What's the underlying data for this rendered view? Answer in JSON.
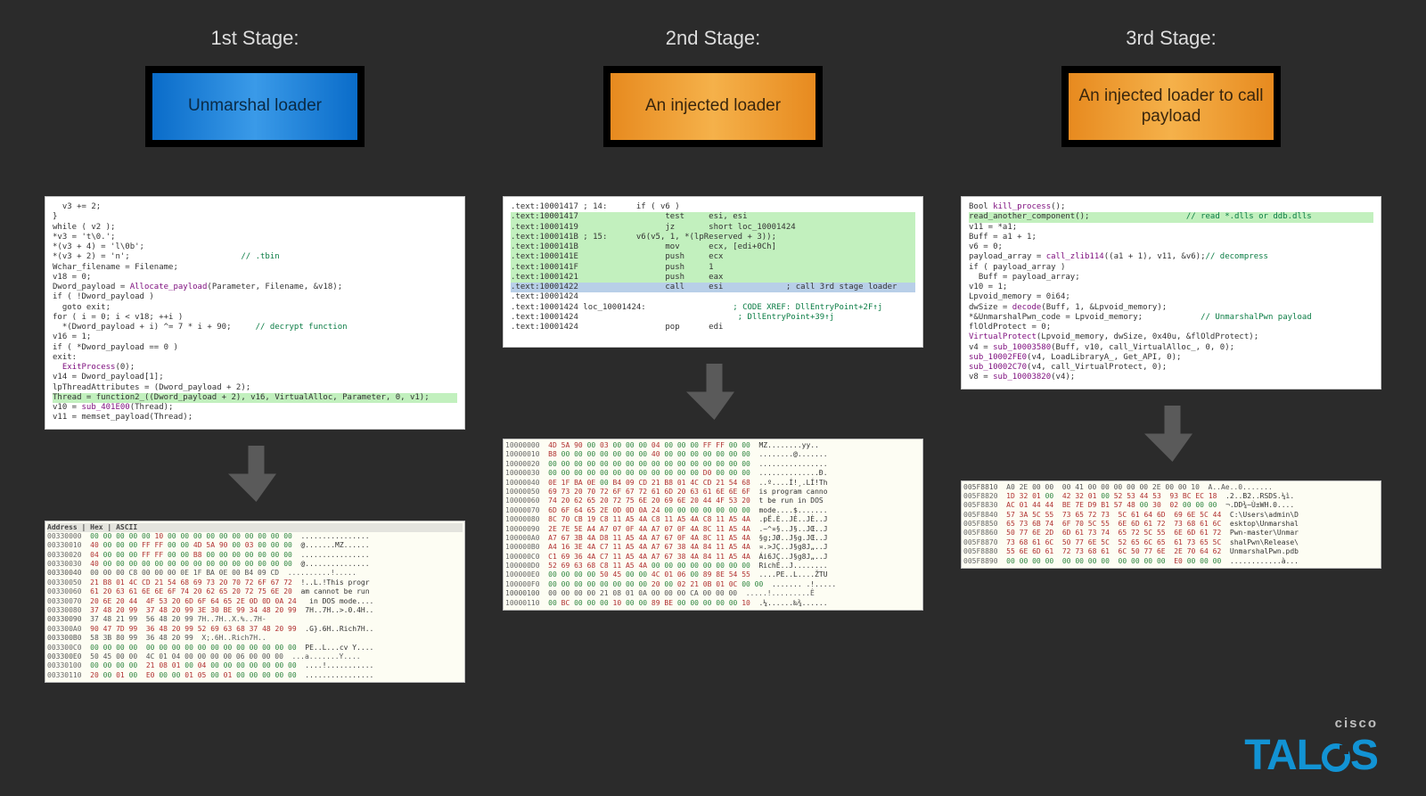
{
  "stages": [
    {
      "title": "1st Stage:",
      "badge": "Unmarshal loader",
      "badge_color": "blue"
    },
    {
      "title": "2nd Stage:",
      "badge": "An injected loader",
      "badge_color": "orange"
    },
    {
      "title": "3rd Stage:",
      "badge": "An injected loader to call payload",
      "badge_color": "orange"
    }
  ],
  "code": {
    "s1": [
      {
        "t": "  v3 += 2;"
      },
      {
        "t": "}"
      },
      {
        "t": "while ( v2 );"
      },
      {
        "t": "*v3 = 't\\0.';"
      },
      {
        "t": "*(v3 + 4) = 'l\\0b';"
      },
      {
        "t": "*(v3 + 2) = 'n';                       ",
        "cm": "// .tbin"
      },
      {
        "t": "Wchar_filename = Filename;"
      },
      {
        "t": "v18 = 0;"
      },
      {
        "t": "Dword_payload = ",
        "fn": "Allocate_payload",
        "t2": "(Parameter, Filename, &v18);"
      },
      {
        "t": "if ( !Dword_payload )"
      },
      {
        "t": "  goto exit;"
      },
      {
        "t": "for ( i = 0; i < v18; ++i )"
      },
      {
        "t": "  *(Dword_payload + i) ^= 7 * i + 90;     ",
        "cm": "// decrypt function"
      },
      {
        "t": "v16 = 1;"
      },
      {
        "t": "if ( *Dword_payload == 0 )"
      },
      {
        "t": "exit:"
      },
      {
        "t": "  ",
        "fn": "ExitProcess",
        "t2": "(0);"
      },
      {
        "t": "v14 = Dword_payload[1];"
      },
      {
        "t": "lpThreadAttributes = (Dword_payload + 2);"
      },
      {
        "hl": true,
        "t": "Thread = function2_((Dword_payload + 2), v16, VirtualAlloc, Parameter, 0, v1);"
      },
      {
        "t": "v10 = ",
        "fn": "sub_401E00",
        "t2": "(Thread);"
      },
      {
        "t": "v11 = memset_payload(Thread);"
      }
    ],
    "s2": [
      {
        "t": ".text:10001417 ; 14:      if ( v6 )"
      },
      {
        "hl": true,
        "t": ".text:10001417                  test     esi, esi"
      },
      {
        "hl": true,
        "t": ".text:10001419                  jz       short loc_10001424"
      },
      {
        "hl": true,
        "t": ".text:1000141B ; 15:      v6(v5, 1, *(lpReserved + 3));"
      },
      {
        "hl": true,
        "t": ".text:1000141B                  mov      ecx, [edi+0Ch]"
      },
      {
        "hl": true,
        "t": ".text:1000141E                  push     ecx"
      },
      {
        "hl": true,
        "t": ".text:1000141F                  push     1"
      },
      {
        "hl": true,
        "t": ".text:10001421                  push     eax"
      },
      {
        "bl": true,
        "t": ".text:10001422                  call     esi             ; call 3rd stage loader"
      },
      {
        "t": ".text:10001424"
      },
      {
        "t": ".text:10001424 loc_10001424:                  ",
        "cm": "; CODE XREF: DllEntryPoint+2F↑j"
      },
      {
        "t": ".text:10001424                                 ",
        "cm": "; DllEntryPoint+39↑j"
      },
      {
        "t": ".text:10001424                  pop      edi"
      }
    ],
    "s3": [
      {
        "t": "Bool ",
        "fn": "kill_process",
        "t2": "();"
      },
      {
        "hl": true,
        "t": "read_another_component();                    ",
        "cm": "// read *.dlls or ddb.dlls"
      },
      {
        "t": "v11 = *a1;"
      },
      {
        "t": "Buff = a1 + 1;"
      },
      {
        "t": "v6 = 0;"
      },
      {
        "t": "payload_array = ",
        "fn": "call_zlib114",
        "t2": "((a1 + 1), v11, &v6);",
        "cm": "// decompress"
      },
      {
        "t": "if ( payload_array )"
      },
      {
        "t": "  Buff = payload_array;"
      },
      {
        "t": "v10 = 1;"
      },
      {
        "t": "Lpvoid_memory = 0i64;"
      },
      {
        "t": "dwSize = ",
        "fn": "decode",
        "t2": "(Buff, 1, &Lpvoid_memory);"
      },
      {
        "t": "*&UnmarshalPwn_code = Lpvoid_memory;            ",
        "cm": "// UnmarshalPwn payload"
      },
      {
        "t": "flOldProtect = 0;"
      },
      {
        "fn": "VirtualProtect",
        "t2": "(Lpvoid_memory, dwSize, 0x40u, &flOldProtect);"
      },
      {
        "t": "v4 = ",
        "fn": "sub_10003580",
        "t2": "(Buff, v10, call_VirtualAlloc_, 0, 0);"
      },
      {
        "fn": "sub_10002FE0",
        "t2": "(v4, LoadLibraryA_, Get_API, 0);"
      },
      {
        "fn": "sub_10002C70",
        "t2": "(v4, call_VirtualProtect, 0);"
      },
      {
        "t": "v8 = ",
        "fn": "sub_10003820",
        "t2": "(v4);"
      }
    ]
  },
  "hex": {
    "s1_header": "Address  | Hex                                                 | ASCII",
    "s1_rows": [
      "00330000  00 00 00 00 00 10 00 00 00 00 00 00 00 00 00 00  ................",
      "00330010  40 00 00 00 FF FF 00 00 4D 5A 90 00 03 00 00 00  @.......MZ......",
      "00330020  04 00 00 00 FF FF 00 00 B8 00 00 00 00 00 00 00  ................",
      "00330030  40 00 00 00 00 00 00 00 00 00 00 00 00 00 00 00  @...............",
      "00330040  00 00 00 C8 00 00 00 0E 1F BA 0E 00 B4 09 CD  ..........!.....",
      "00330050  21 B8 01 4C CD 21 54 68 69 73 20 70 72 6F 67 72  !..L.!This progr",
      "00330060  61 20 63 61 6E 6E 6F 74 20 62 65 20 72 75 6E 20  am cannot be run",
      "00330070  20 6E 20 44  4F 53 20 6D 6F 64 65 2E 0D 0D 0A 24   in DOS mode....",
      "00330080  37 48 20 99  37 48 20 99 3E 30 BE 99 34 48 20 99  7H..7H..>.0.4H..",
      "00330090  37 48 21 99  56 48 20 99 7H..7H..X.%..7H-",
      "003300A0  90 47 7D 99  36 48 20 99 52 69 63 68 37 48 20 99  .G}.6H..Rich7H..",
      "003300B0  58 3B 80 99  36 48 20 99  X;.6H..Rich7H..",
      "003300C0  00 00 00 00  00 00 00 00 00 00 00 00 00 00 00 00  PE..L...cv Y....",
      "003300E0  50 45 00 00  4C 01 04 00 00 00 00 06 00 00 00  ...a.......Y....",
      "00330100  00 00 00 00  21 08 01 00 04 00 00 00 00 00 00 00  ....!...........",
      "00330110  20 00 01 00  E0 00 00 01 05 00 01 00 00 00 00 00  ................"
    ],
    "s2_rows": [
      "10000000  4D 5A 90 00 03 00 00 00 04 00 00 00 FF FF 00 00  MZ........yy..",
      "10000010  B8 00 00 00 00 00 00 00 40 00 00 00 00 00 00 00  ........@.......",
      "10000020  00 00 00 00 00 00 00 00 00 00 00 00 00 00 00 00  ................",
      "10000030  00 00 00 00 00 00 00 00 00 00 00 00 D0 00 00 00  ..............Ð.",
      "10000040  0E 1F BA 0E 00 B4 09 CD 21 B8 01 4C CD 21 54 68  ..º....Í!¸.LÍ!Th",
      "10000050  69 73 20 70 72 6F 67 72 61 6D 20 63 61 6E 6E 6F  is program canno",
      "10000060  74 20 62 65 20 72 75 6E 20 69 6E 20 44 4F 53 20  t be run in DOS ",
      "10000070  6D 6F 64 65 2E 0D 0D 0A 24 00 00 00 00 00 00 00  mode....$.......",
      "10000080  8C 70 CB 19 C8 11 A5 4A C8 11 A5 4A C8 11 A5 4A  .pË.È..JÈ..JÈ..J",
      "10000090  2E 7E 5E A4 A7 07 0F 4A A7 07 0F 4A 8C 11 A5 4A  .~^¤§..J§..JŒ..J",
      "100000A0  A7 67 3B 4A D8 11 A5 4A A7 67 0F 4A 8C 11 A5 4A  §g;JØ..J§g.JŒ..J",
      "100000B0  A4 16 3E 4A C7 11 A5 4A A7 67 38 4A 84 11 A5 4A  ¤.>JÇ..J§g8J„..J",
      "100000C0  C1 69 36 4A C7 11 A5 4A A7 67 38 4A 84 11 A5 4A  Ái6JÇ..J§g8J„..J",
      "100000D0  52 69 63 68 C8 11 A5 4A 00 00 00 00 00 00 00 00  RichÈ..J........",
      "100000E0  00 00 00 00 50 45 00 00 4C 01 06 00 89 8E 54 55  ....PE..L....ŽTU",
      "100000F0  00 00 00 00 00 00 00 00 20 00 02 21 0B 01 0C 00 00  ....... .!.....",
      "10000100  00 00 00 00 21 08 01 0A 00 00 00 CA 00 00 00  .....!.........Ê",
      "10000110  00 BC 00 00 00 10 00 00 89 BE 00 00 00 00 00 10  .¼......‰¾......"
    ],
    "s3_rows": [
      "005F8810  A0 2E 00 00  00 41 00 00 00 00 00 2E 00 00 10  A..Ae..0.......",
      "005F8820  1D 32 01 00  42 32 01 00 52 53 44 53  93 BC EC 18  .2..B2..RSDS.¼ì.",
      "005F8830  AC 01 44 44  BE 7E D9 B1 57 48 00 30  02 00 00 00  ¬.DD¾~Ù±WH.0....",
      "005F8840  57 3A 5C 55  73 65 72 73  5C 61 64 6D  69 6E 5C 44  C:\\Users\\admin\\D",
      "005F8850  65 73 6B 74  6F 70 5C 55  6E 6D 61 72  73 68 61 6C  esktop\\Unmarshal",
      "005F8860  50 77 6E 2D  6D 61 73 74  65 72 5C 55  6E 6D 61 72  Pwn-master\\Unmar",
      "005F8870  73 68 61 6C  50 77 6E 5C  52 65 6C 65  61 73 65 5C  shalPwn\\Release\\",
      "005F8880  55 6E 6D 61  72 73 68 61  6C 50 77 6E  2E 70 64 62  UnmarshalPwn.pdb",
      "005F8890  00 00 00 00  00 00 00 00  00 00 00 00  E0 00 00 00  ............à..."
    ]
  },
  "brand": {
    "cisco": "cisco",
    "talos": "TALOS"
  }
}
